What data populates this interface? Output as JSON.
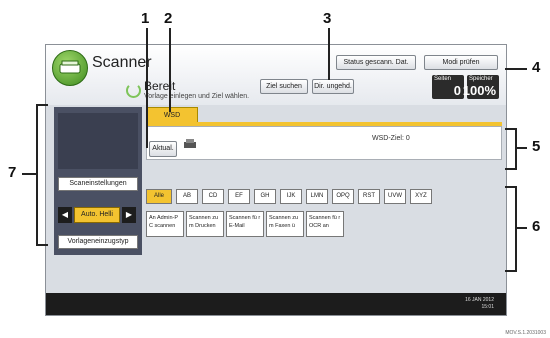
{
  "callouts": [
    "1",
    "2",
    "3",
    "4",
    "5",
    "6",
    "7"
  ],
  "app": {
    "title": "Scanner",
    "status": "Bereit",
    "status_sub": "Vorlage einlegen und Ziel wählen."
  },
  "header_buttons": {
    "status_scan": "Status gescann. Dat.",
    "mode_check": "Modi prüfen",
    "search_dest": "Ziel suchen",
    "register_dest": "Dir. ungehd."
  },
  "counters": {
    "originals_label": "Seiten",
    "originals_value": "0",
    "memory_label": "Speicher",
    "memory_value": "100%"
  },
  "left": {
    "scan_settings": "Scaneinstellungen",
    "auto_density": "Auto. Helli",
    "original_feed": "Vorlageneinzugstyp"
  },
  "tab": {
    "label": "WSD"
  },
  "destination": {
    "refresh": "Aktual.",
    "label": "WSD-Ziel: 0"
  },
  "letters": [
    "Alle",
    "AB",
    "CD",
    "EF",
    "GH",
    "IJK",
    "LMN",
    "OPQ",
    "RST",
    "UVW",
    "XYZ"
  ],
  "dest_buttons": [
    "An Admin-P C scannen",
    "Scannen zu m Drucken",
    "Scannen fü r E-Mail",
    "Scannen zu m Faxen ü",
    "Scannen fü r OCR an"
  ],
  "datetime": {
    "date": "16 JAN 2012",
    "time": "15:01"
  },
  "image_id": "MOV.S.1.2031003"
}
